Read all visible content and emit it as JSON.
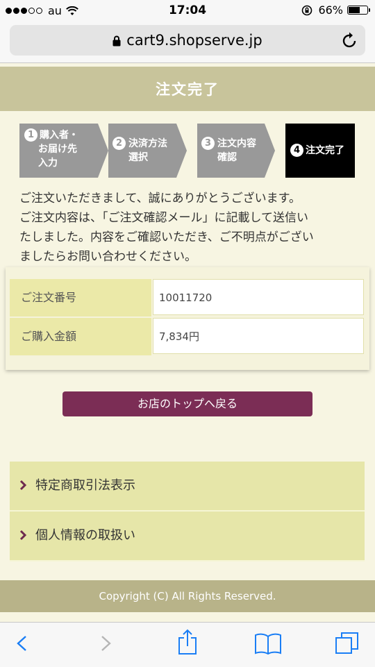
{
  "status_bar": {
    "carrier": "au",
    "time": "17:04",
    "battery_percent": "66%",
    "battery_level": 0.66,
    "signal_bars_full": 3,
    "signal_bars_total": 5
  },
  "browser": {
    "url": "cart9.shopserve.jp"
  },
  "header": {
    "title": "注文完了"
  },
  "steps": [
    {
      "number": "1",
      "label_line1": "購入者・",
      "label_line2": "お届け先",
      "label_line3": "入力",
      "active": false
    },
    {
      "number": "2",
      "label_line1": "決済方法",
      "label_line2": "選択",
      "active": false
    },
    {
      "number": "3",
      "label_line1": "注文内容",
      "label_line2": "確認",
      "active": false
    },
    {
      "number": "4",
      "label_line1": "注文完了",
      "active": true
    }
  ],
  "message": {
    "lines": [
      "ご注文いただきまして、誠にありがとうございます。",
      "ご注文内容は、「ご注文確認メール」に記載して送信い",
      "たしました。内容をご確認いただき、ご不明点がござい",
      "ましたらお問い合わせください。"
    ]
  },
  "order": {
    "rows": [
      {
        "label": "ご注文番号",
        "value": "10011720"
      },
      {
        "label": "ご購入金額",
        "value": "7,834円"
      }
    ]
  },
  "actions": {
    "back_to_top": "お店のトップへ戻る"
  },
  "links": [
    {
      "label": "特定商取引法表示"
    },
    {
      "label": "個人情報の取扱い"
    }
  ],
  "footer": {
    "copyright": "Copyright (C) All Rights Reserved."
  },
  "colors": {
    "header_bg": "#c8c49b",
    "step_inactive": "#999999",
    "step_active": "#000000",
    "button": "#7b2d55",
    "link_bg": "#e6e6a9",
    "ios_blue": "#1a7ef5"
  },
  "toolbar_icons": [
    "back-icon",
    "forward-icon",
    "share-icon",
    "bookmarks-icon",
    "tabs-icon"
  ]
}
